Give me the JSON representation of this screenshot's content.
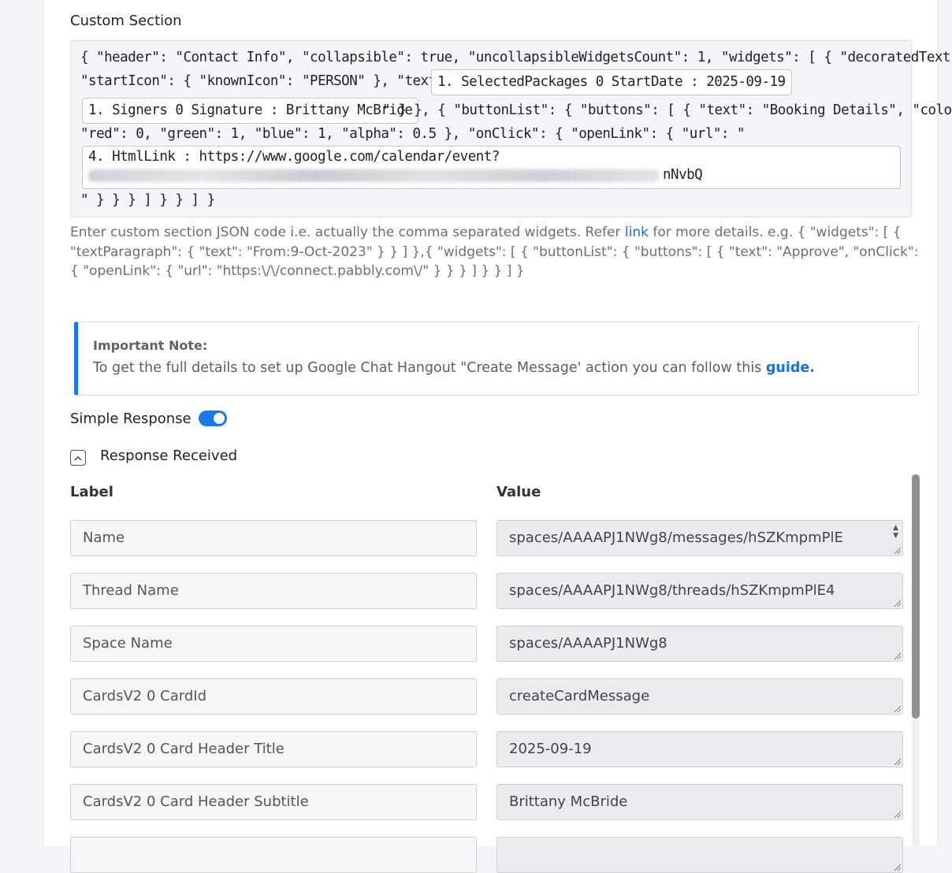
{
  "section": {
    "title": "Custom Section",
    "json_lines": [
      "{ \"header\": \"Contact Info\", \"collapsible\": true, \"uncollapsibleWidgetsCount\": 1, \"widgets\": [ { \"decoratedText\": {",
      "\"startIcon\": { \"knownIcon\": \"PERSON\" }, \"text\": \"",
      "-",
      "\" } }, { \"buttonList\": { \"buttons\": [ { \"text\": \"Booking Details\", \"color\": {",
      "\"red\": 0, \"green\": 1, \"blue\": 1, \"alpha\": 0.5 }, \"onClick\": { \"openLink\": { \"url\": \"",
      "\" } } } ] } } ] }"
    ],
    "chips": {
      "selected_packages": "1. SelectedPackages 0 StartDate : 2025-09-19",
      "signers": "1. Signers 0 Signature : Brittany McBride",
      "html_link_line1": "4. HtmlLink : https://www.google.com/calendar/event?",
      "html_link_tail": "nNvbQ"
    }
  },
  "help": {
    "pre": "Enter custom section JSON code i.e. actually the comma separated widgets. Refer ",
    "link": "link",
    "post": " for more details. e.g. { \"widgets\": [ { \"textParagraph\": { \"text\": \"From:9-Oct-2023\" } } ] },{ \"widgets\": [ { \"buttonList\": { \"buttons\": [ { \"text\": \"Approve\", \"onClick\": { \"openLink\": { \"url\": \"https:\\/\\/connect.pabbly.com\\/\" } } } ] } } ] }"
  },
  "note": {
    "title": "Important Note:",
    "text": "To get the full details to set up Google Chat Hangout \"Create Message' action you can follow this ",
    "link": "guide."
  },
  "simple_response": {
    "label": "Simple Response",
    "enabled": true
  },
  "response": {
    "title": "Response Received",
    "label_header": "Label",
    "value_header": "Value",
    "rows": [
      {
        "label": "Name",
        "value": "spaces/AAAAPJ1NWg8/messages/hSZKmpmPlE"
      },
      {
        "label": "Thread Name",
        "value": "spaces/AAAAPJ1NWg8/threads/hSZKmpmPlE4"
      },
      {
        "label": "Space Name",
        "value": "spaces/AAAAPJ1NWg8"
      },
      {
        "label": "CardsV2 0 CardId",
        "value": "createCardMessage"
      },
      {
        "label": "CardsV2 0 Card Header Title",
        "value": "2025-09-19"
      },
      {
        "label": "CardsV2 0 Card Header Subtitle",
        "value": "Brittany McBride"
      },
      {
        "label": "",
        "value": ""
      }
    ]
  }
}
